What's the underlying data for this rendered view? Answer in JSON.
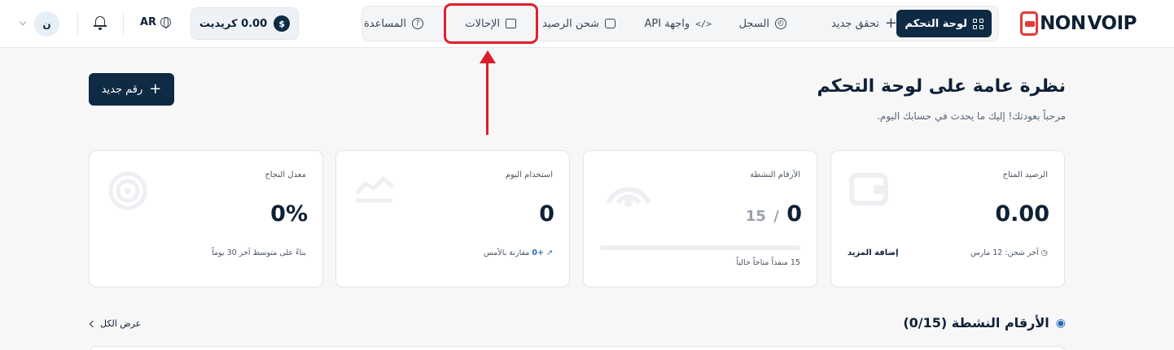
{
  "brand": {
    "logo_part1": "NON",
    "logo_part2": "VOIP"
  },
  "nav": {
    "items": [
      {
        "label": "لوحة التحكم",
        "icon": "dashboard-grid-icon",
        "active": true
      },
      {
        "label": "تحقق جديد",
        "icon": "plus-icon"
      },
      {
        "label": "السجل",
        "icon": "history-icon"
      },
      {
        "label": "واجهة API",
        "icon": "code-icon"
      },
      {
        "label": "شحن الرصيد",
        "icon": "wallet-icon"
      },
      {
        "label": "الإحالات",
        "icon": "gift-icon"
      },
      {
        "label": "المساعدة",
        "icon": "help-circle-icon"
      }
    ]
  },
  "header": {
    "credit_label": "0.00 كريديت",
    "currency_symbol": "$",
    "language": "AR",
    "avatar_initial": "ن"
  },
  "page": {
    "title": "نظرة عامة على لوحة التحكم",
    "subtitle": "مرحباً بعودتك! إليك ما يحدث في حسابك اليوم.",
    "new_number_label": "رقم جديد"
  },
  "cards": {
    "balance": {
      "label": "الرصيد المتاح",
      "value": "0.00",
      "footer": "آخر شحن: 12 مارس",
      "action": "إضافة المزيد"
    },
    "active_numbers": {
      "label": "الأرقام النشطة",
      "value": "0",
      "total": "15",
      "separator": "/",
      "footer": "15 منفذاً متاحاً حالياً",
      "progress": 0
    },
    "usage_today": {
      "label": "استخدام اليوم",
      "value": "0",
      "footer_delta": "+0",
      "footer_text": "مقارنة بالأمس"
    },
    "success_rate": {
      "label": "معدل النجاح",
      "value": "0%",
      "footer": "بناءً على متوسط آخر 30 يوماً"
    }
  },
  "active_section": {
    "title": "الأرقام النشطة (0/15)",
    "view_all": "عرض الكل"
  },
  "colors": {
    "primary": "#0f2a45",
    "accent": "#e53935",
    "highlight": "#e0202e"
  }
}
